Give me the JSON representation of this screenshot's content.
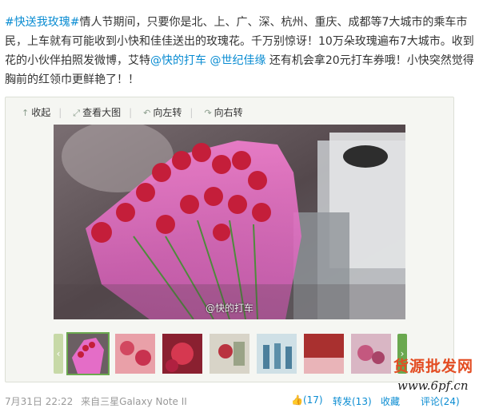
{
  "post": {
    "topic1": "#快送我玫瑰#",
    "text1": "情人节期间，只要你是北、上、广、深、杭州、重庆、成都等7大城市的乘车市民，上车就有可能收到小快和佳佳送出的玫瑰花。千万别惊讶！10万朵玫瑰遍布7大城市。收到花的小伙伴拍照发微博，艾特",
    "mention1": "@快的打车",
    "text2": " ",
    "mention2": "@世纪佳缘",
    "text3": " 还有机会拿20元打车券哦！小快突然觉得胸前的红领巾更鲜艳了！！"
  },
  "media": {
    "toolbar": [
      {
        "icon": "collapse-icon",
        "glyph": "↑",
        "label": "收起"
      },
      {
        "icon": "view-large-icon",
        "glyph": "⤢",
        "label": "查看大图"
      },
      {
        "icon": "rotate-left-icon",
        "glyph": "↶",
        "label": "向左转"
      },
      {
        "icon": "rotate-right-icon",
        "glyph": "↷",
        "label": "向右转"
      }
    ],
    "photo_watermark": "@快的打车",
    "prev_arrow": "‹",
    "next_arrow": "›"
  },
  "footer": {
    "date": "7月31日 22:22",
    "source": "来自三星Galaxy Note II",
    "like": "(17)",
    "forward": "转发(13)",
    "favorite": "收藏",
    "comment": "评论(24)"
  },
  "watermark": {
    "site": "货源批发网",
    "url": "www.6pf.cn"
  },
  "colors": {
    "link": "#0a8cd2",
    "accent_green": "#6aa84f",
    "watermark_red": "#e34d23"
  }
}
